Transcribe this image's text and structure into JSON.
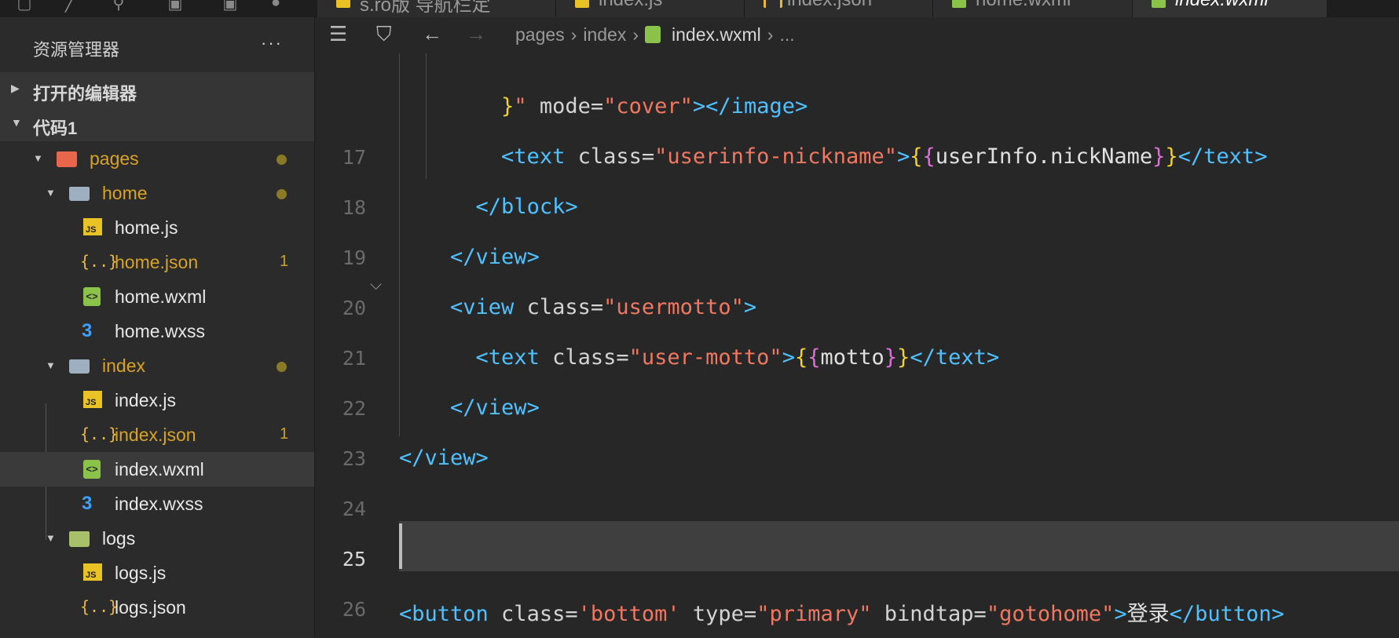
{
  "tabs": [
    {
      "label": "s.ro版 导航栏定",
      "color": "#e9c225"
    },
    {
      "label": "index.js",
      "color": "#e9c225"
    },
    {
      "label": "index.json",
      "color": "#e8b93a"
    },
    {
      "label": "home.wxml",
      "color": "#8bc34a"
    },
    {
      "label": "index.wxml",
      "color": "#8bc34a"
    }
  ],
  "sidebar": {
    "title": "资源管理器",
    "more": "···",
    "sections": [
      {
        "label": "打开的编辑器"
      },
      {
        "label": "代码1"
      }
    ],
    "tree": [
      {
        "name": "pages",
        "badge": "●"
      },
      {
        "name": "home",
        "badge": "●"
      },
      {
        "name": "home.js",
        "badge": ""
      },
      {
        "name": "home.json",
        "badge": "1"
      },
      {
        "name": "home.wxml",
        "badge": ""
      },
      {
        "name": "home.wxss",
        "badge": ""
      },
      {
        "name": "index",
        "badge": "●"
      },
      {
        "name": "index.js",
        "badge": ""
      },
      {
        "name": "index.json",
        "badge": "1"
      },
      {
        "name": "index.wxml",
        "badge": ""
      },
      {
        "name": "index.wxss",
        "badge": ""
      },
      {
        "name": "logs",
        "badge": ""
      },
      {
        "name": "logs.js",
        "badge": ""
      },
      {
        "name": "logs.json",
        "badge": ""
      }
    ]
  },
  "breadcrumb": {
    "items": [
      "pages",
      "index",
      "index.wxml",
      "..."
    ]
  },
  "editor": {
    "current_line": "25",
    "lines": [
      {
        "num": "",
        "parts": [
          [
            "punc",
            "        "
          ],
          [
            "b1",
            "}"
          ],
          [
            "str",
            "\""
          ],
          [
            "attr",
            " mode="
          ],
          [
            "str",
            "\"cover\""
          ],
          [
            "tag",
            "></image>"
          ]
        ]
      },
      {
        "num": "17",
        "parts": [
          [
            "punc",
            "        "
          ],
          [
            "tag",
            "<text"
          ],
          [
            "attr",
            " class="
          ],
          [
            "str",
            "\"userinfo-nickname\""
          ],
          [
            "tag",
            ">"
          ],
          [
            "b1",
            "{"
          ],
          [
            "b2",
            "{"
          ],
          [
            "txt",
            "userInfo.nickName"
          ],
          [
            "b2",
            "}"
          ],
          [
            "b1",
            "}"
          ],
          [
            "tag",
            "</text>"
          ]
        ]
      },
      {
        "num": "18",
        "parts": [
          [
            "punc",
            "      "
          ],
          [
            "tag",
            "</block>"
          ]
        ]
      },
      {
        "num": "19",
        "parts": [
          [
            "punc",
            "    "
          ],
          [
            "tag",
            "</view>"
          ]
        ]
      },
      {
        "num": "20",
        "parts": [
          [
            "punc",
            "    "
          ],
          [
            "tag",
            "<view"
          ],
          [
            "attr",
            " class="
          ],
          [
            "str",
            "\"usermotto\""
          ],
          [
            "tag",
            ">"
          ]
        ]
      },
      {
        "num": "21",
        "parts": [
          [
            "punc",
            "      "
          ],
          [
            "tag",
            "<text"
          ],
          [
            "attr",
            " class="
          ],
          [
            "str",
            "\"user-motto\""
          ],
          [
            "tag",
            ">"
          ],
          [
            "b1",
            "{"
          ],
          [
            "b2",
            "{"
          ],
          [
            "txt",
            "motto"
          ],
          [
            "b2",
            "}"
          ],
          [
            "b1",
            "}"
          ],
          [
            "tag",
            "</text>"
          ]
        ]
      },
      {
        "num": "22",
        "parts": [
          [
            "punc",
            "    "
          ],
          [
            "tag",
            "</view>"
          ]
        ]
      },
      {
        "num": "23",
        "parts": [
          [
            "tag",
            "</view>"
          ]
        ]
      },
      {
        "num": "24",
        "parts": []
      },
      {
        "num": "25",
        "parts": []
      },
      {
        "num": "26",
        "parts": [
          [
            "tag",
            "<button"
          ],
          [
            "attr",
            " class="
          ],
          [
            "str",
            "'bottom'"
          ],
          [
            "attr",
            " type="
          ],
          [
            "str",
            "\"primary\""
          ],
          [
            "attr",
            " bindtap="
          ],
          [
            "str",
            "\"gotohome\""
          ],
          [
            "tag",
            ">"
          ],
          [
            "txt",
            "登录"
          ],
          [
            "tag",
            "</button>"
          ]
        ]
      }
    ]
  },
  "colors": {
    "tag": "#4fc1ff",
    "string": "#f07862",
    "bracket_outer": "#f0d130",
    "bracket_inner": "#da70d6",
    "modified": "#d7a327"
  }
}
